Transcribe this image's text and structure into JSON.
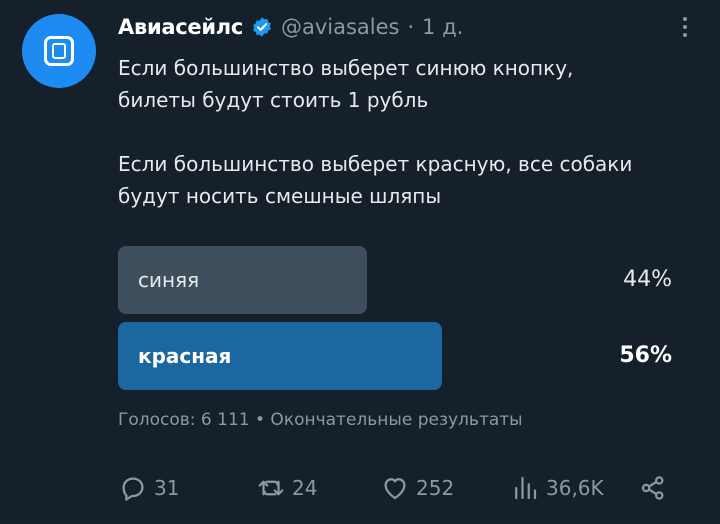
{
  "author": {
    "name": "Авиасейлс",
    "handle": "@aviasales",
    "separator": "·",
    "time": "1 д."
  },
  "tweet": {
    "line1": "Если большинство выберет синюю кнопку,",
    "line2": "билеты будут стоить 1 рубль",
    "line3": "Если большинство выберет красную, все собаки",
    "line4": "будут носить смешные шляпы"
  },
  "poll": {
    "options": [
      {
        "label": "синяя",
        "percent_text": "44%",
        "percent": 44,
        "color": "#3f4e5d"
      },
      {
        "label": "красная",
        "percent_text": "56%",
        "percent": 56,
        "color": "#1d67a0"
      }
    ],
    "meta": "Голосов: 6 111 • Окончательные результаты"
  },
  "actions": {
    "replies": "31",
    "retweets": "24",
    "likes": "252",
    "views": "36,6K"
  },
  "colors": {
    "background": "#15202b",
    "accent": "#1d9bf0",
    "muted": "#8b98a5"
  },
  "icons": [
    "verified-icon",
    "more-icon",
    "reply-icon",
    "retweet-icon",
    "like-icon",
    "views-icon",
    "share-icon"
  ]
}
